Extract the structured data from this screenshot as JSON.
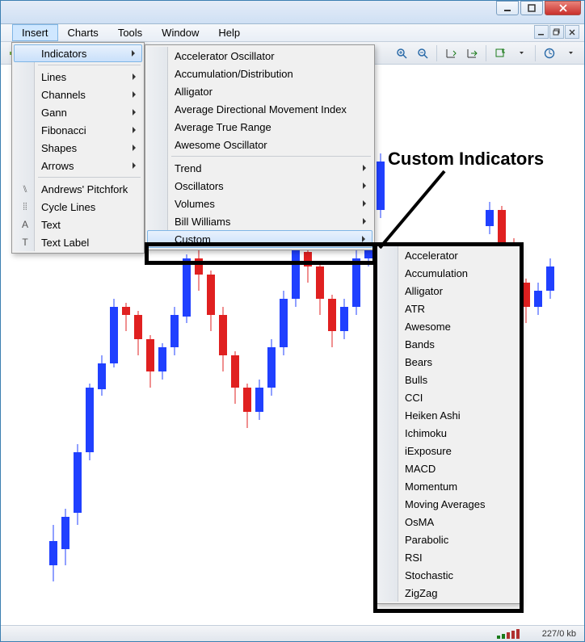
{
  "menubar": [
    "Insert",
    "Charts",
    "Tools",
    "Window",
    "Help"
  ],
  "active_menu": "Insert",
  "insert_menu": {
    "groups": [
      [
        {
          "label": "Indicators",
          "sub": true,
          "highlight": true
        }
      ],
      [
        {
          "label": "Lines",
          "sub": true
        },
        {
          "label": "Channels",
          "sub": true
        },
        {
          "label": "Gann",
          "sub": true
        },
        {
          "label": "Fibonacci",
          "sub": true
        },
        {
          "label": "Shapes",
          "sub": true
        },
        {
          "label": "Arrows",
          "sub": true
        }
      ],
      [
        {
          "label": "Andrews' Pitchfork",
          "icon": "pitchfork"
        },
        {
          "label": "Cycle Lines",
          "icon": "cycle"
        },
        {
          "label": "Text",
          "icon": "text"
        },
        {
          "label": "Text Label",
          "icon": "textlabel"
        }
      ]
    ]
  },
  "indicators_menu": {
    "groups": [
      [
        {
          "label": "Accelerator Oscillator"
        },
        {
          "label": "Accumulation/Distribution"
        },
        {
          "label": "Alligator"
        },
        {
          "label": "Average Directional Movement Index"
        },
        {
          "label": "Average True Range"
        },
        {
          "label": "Awesome Oscillator"
        }
      ],
      [
        {
          "label": "Trend",
          "sub": true
        },
        {
          "label": "Oscillators",
          "sub": true
        },
        {
          "label": "Volumes",
          "sub": true
        },
        {
          "label": "Bill Williams",
          "sub": true
        },
        {
          "label": "Custom",
          "sub": true,
          "highlight": true
        }
      ]
    ]
  },
  "custom_menu": {
    "items": [
      {
        "label": "Accelerator"
      },
      {
        "label": "Accumulation"
      },
      {
        "label": "Alligator"
      },
      {
        "label": "ATR"
      },
      {
        "label": "Awesome"
      },
      {
        "label": "Bands"
      },
      {
        "label": "Bears"
      },
      {
        "label": "Bulls"
      },
      {
        "label": "CCI"
      },
      {
        "label": "Heiken Ashi"
      },
      {
        "label": "Ichimoku"
      },
      {
        "label": "iExposure"
      },
      {
        "label": "MACD"
      },
      {
        "label": "Momentum"
      },
      {
        "label": "Moving Averages"
      },
      {
        "label": "OsMA"
      },
      {
        "label": "Parabolic"
      },
      {
        "label": "RSI"
      },
      {
        "label": "Stochastic"
      },
      {
        "label": "ZigZag"
      }
    ]
  },
  "annotation": "Custom Indicators",
  "status": "227/0 kb"
}
